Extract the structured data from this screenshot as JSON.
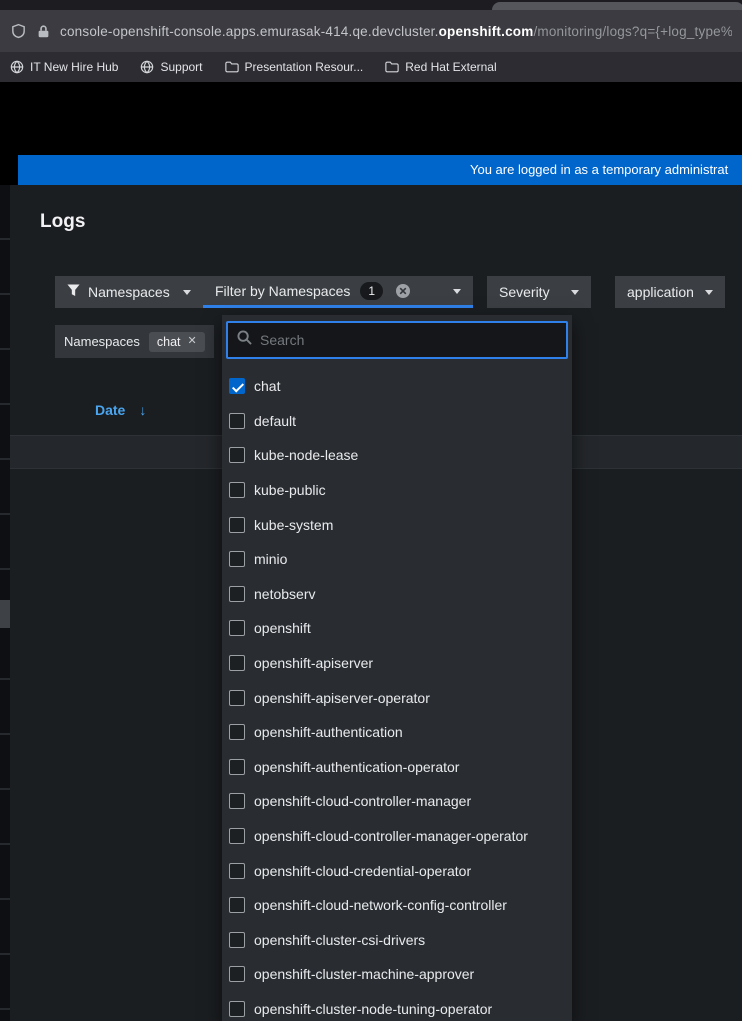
{
  "browser": {
    "url": {
      "prefix": "console-openshift-console.apps.emurasak-414.qe.devcluster.",
      "domain": "openshift.com",
      "path": "/monitoring/logs?q={+log_type%"
    },
    "bookmarks": [
      {
        "label": "IT New Hire Hub",
        "icon": "globe-icon"
      },
      {
        "label": "Support",
        "icon": "globe-icon"
      },
      {
        "label": "Presentation Resour...",
        "icon": "folder-icon"
      },
      {
        "label": "Red Hat External",
        "icon": "folder-icon"
      }
    ]
  },
  "banner": {
    "text": "You are logged in as a temporary administrat"
  },
  "page": {
    "title": "Logs"
  },
  "toolbar": {
    "namespaces_toggle": {
      "label": "Namespaces"
    },
    "filter_select": {
      "label": "Filter by Namespaces",
      "badge": "1"
    },
    "severity_select": {
      "label": "Severity"
    },
    "log_type_select": {
      "label": "application"
    }
  },
  "chip_group": {
    "label": "Namespaces",
    "chips": [
      "chat"
    ]
  },
  "dropdown": {
    "search_placeholder": "Search",
    "options": [
      {
        "label": "chat",
        "checked": true
      },
      {
        "label": "default",
        "checked": false
      },
      {
        "label": "kube-node-lease",
        "checked": false
      },
      {
        "label": "kube-public",
        "checked": false
      },
      {
        "label": "kube-system",
        "checked": false
      },
      {
        "label": "minio",
        "checked": false
      },
      {
        "label": "netobserv",
        "checked": false
      },
      {
        "label": "openshift",
        "checked": false
      },
      {
        "label": "openshift-apiserver",
        "checked": false
      },
      {
        "label": "openshift-apiserver-operator",
        "checked": false
      },
      {
        "label": "openshift-authentication",
        "checked": false
      },
      {
        "label": "openshift-authentication-operator",
        "checked": false
      },
      {
        "label": "openshift-cloud-controller-manager",
        "checked": false
      },
      {
        "label": "openshift-cloud-controller-manager-operator",
        "checked": false
      },
      {
        "label": "openshift-cloud-credential-operator",
        "checked": false
      },
      {
        "label": "openshift-cloud-network-config-controller",
        "checked": false
      },
      {
        "label": "openshift-cluster-csi-drivers",
        "checked": false
      },
      {
        "label": "openshift-cluster-machine-approver",
        "checked": false
      },
      {
        "label": "openshift-cluster-node-tuning-operator",
        "checked": false
      }
    ]
  },
  "table": {
    "sort_column": "Date",
    "sort_icon": "arrow-down",
    "sort_arrow": "↓"
  },
  "colors": {
    "banner": "#0066cc",
    "focus_border": "#2f80e8",
    "sorted_column": "#4aa5f0",
    "checkbox_checked": "#0066cc"
  }
}
